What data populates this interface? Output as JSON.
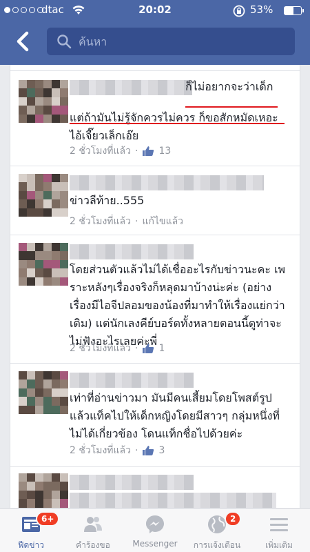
{
  "status_bar": {
    "carrier": "dtac",
    "time": "20:02",
    "battery": "53%",
    "battery_level": 0.53,
    "signal_bars_filled": 1
  },
  "search": {
    "placeholder": "ค้นหา"
  },
  "comments": [
    {
      "lines": [
        "ก็ไม่อยากจะว่าเด็ก",
        "แต่ถ้ามันไม่รู้จักควรไม่ควร ก็ขอสักหมัดเหอะ",
        "ไอ้เจี๊ยวเล็กเอ๊ย"
      ],
      "time": "2 ชั่วโมงที่แล้ว",
      "likes": "13"
    },
    {
      "lines": [
        "ข่าวลีท้าย..555"
      ],
      "time": "2 ชั่วโมงที่แล้ว",
      "action": "แก้ไขแล้ว"
    },
    {
      "lines": [
        "โดยส่วนตัวแล้วไม่ได้เชื่ออะไรกับข่าวนะคะ เพ",
        "ราะหลังๆเรื่องจริงก็หลุดมาบ้างน่ะค่ะ (อย่าง",
        "เรื่องมีไอจีปลอมของน้องที่มาทำให้เรื่องแย่กว่า",
        "เดิม) แต่นักเลงคีย์บอร์ดทั้งหลายตอนนี้ดูท่าจะ",
        "ไม่ฟังอะไรเลยค่ะพี่"
      ],
      "time": "2 ชั่วโมงที่แล้ว",
      "likes": "1"
    },
    {
      "lines": [
        "เท่าที่อ่านข่าวมา มันมีคนเสี้ยมโดยโพสต์รูป",
        "แล้วแท็คไปให้เด็กหญิงโดยมีสาวๆ กลุ่มหนึ่งที่",
        "ไม่ได้เกี่ยวข้อง โดนแท็กชื่อไปด้วยค่ะ"
      ],
      "time": "2 ชั่วโมงที่แล้ว",
      "likes": "3"
    }
  ],
  "tabs": [
    {
      "label": "ฟีดข่าว",
      "icon": "news-feed-icon",
      "badge": "6+"
    },
    {
      "label": "คำร้องขอ",
      "icon": "friend-requests-icon"
    },
    {
      "label": "Messenger",
      "icon": "messenger-icon"
    },
    {
      "label": "การแจ้งเตือน",
      "icon": "globe-icon",
      "badge": "2"
    },
    {
      "label": "เพิ่มเติม",
      "icon": "menu-icon"
    }
  ],
  "colors": {
    "brand": "#4b67a6",
    "search_bg": "#354e8e",
    "badge": "#f03d25",
    "underline": "#e0181e",
    "meta": "#90949c"
  }
}
